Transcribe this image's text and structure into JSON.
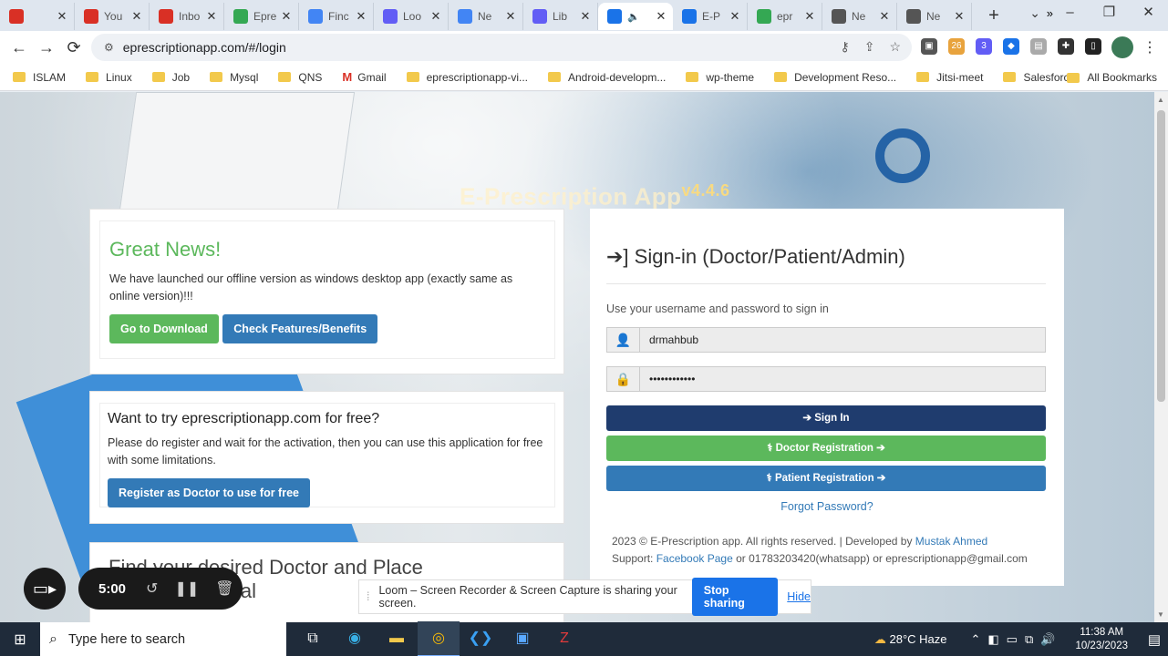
{
  "browser": {
    "tabs": [
      {
        "label": "",
        "color": "#d93025"
      },
      {
        "label": "You",
        "color": "#d93025"
      },
      {
        "label": "Inbo",
        "color": "#d93025"
      },
      {
        "label": "Epre",
        "color": "#34a853"
      },
      {
        "label": "Finc",
        "color": "#4285f4"
      },
      {
        "label": "Loo",
        "color": "#625df5"
      },
      {
        "label": "Ne",
        "color": "#4285f4"
      },
      {
        "label": "Lib",
        "color": "#625df5"
      },
      {
        "label": "",
        "color": "#1a73e8",
        "active": true
      },
      {
        "label": "E-P",
        "color": "#1a73e8"
      },
      {
        "label": "epr",
        "color": "#34a853"
      },
      {
        "label": "Ne",
        "color": "#555555"
      },
      {
        "label": "Ne",
        "color": "#555555"
      }
    ],
    "url": "eprescriptionapp.com/#/login",
    "extensions_badges": [
      "26",
      "3"
    ],
    "bookmarks": [
      "ISLAM",
      "Linux",
      "Job",
      "Mysql",
      "QNS",
      "Gmail",
      "eprescriptionapp-vi...",
      "Android-developm...",
      "wp-theme",
      "Development Reso...",
      "Jitsi-meet",
      "Salesforce"
    ],
    "bookmarks_all": "All Bookmarks",
    "bookmarks_more": "»"
  },
  "page": {
    "watermark_title": "E-Prescription App",
    "watermark_version": "v4.4.6",
    "news": {
      "headline": "Great News!",
      "text": "We have launched our offline version as windows desktop app (exactly same as online version)!!!",
      "download_label": "Go to Download",
      "features_label": "Check Features/Benefits"
    },
    "trial": {
      "headline": "Want to try eprescriptionapp.com for free?",
      "text": "Please do register and wait for the activation, then you can use this application for free with some limitations.",
      "register_label": "Register as Doctor to use for free"
    },
    "find": {
      "title_line1": "Find your desired Doctor and Place",
      "title_line2": "ial"
    },
    "signin": {
      "title": "Sign-in (Doctor/Patient/Admin)",
      "hint": "Use your username and password to sign in",
      "username": "drmahbub",
      "password_mask": "••••••••••••",
      "signin_label": "Sign In",
      "doctor_reg_label": "Doctor Registration",
      "patient_reg_label": "Patient Registration",
      "forgot_label": "Forgot Password?",
      "footer_copyright": "2023 © E-Prescription app. All rights reserved. | Developed by ",
      "footer_author": "Mustak Ahmed",
      "footer_support_prefix": "Support: ",
      "footer_facebook": "Facebook Page",
      "footer_contact": " or 01783203420(whatsapp) or eprescriptionapp@gmail.com"
    }
  },
  "loom": {
    "timer": "5:00",
    "share_text": "Loom – Screen Recorder & Screen Capture is sharing your screen.",
    "stop_label": "Stop sharing",
    "hide_label": "Hide"
  },
  "taskbar": {
    "search_placeholder": "Type here to search",
    "weather": "28°C  Haze",
    "time": "11:38 AM",
    "date": "10/23/2023"
  }
}
